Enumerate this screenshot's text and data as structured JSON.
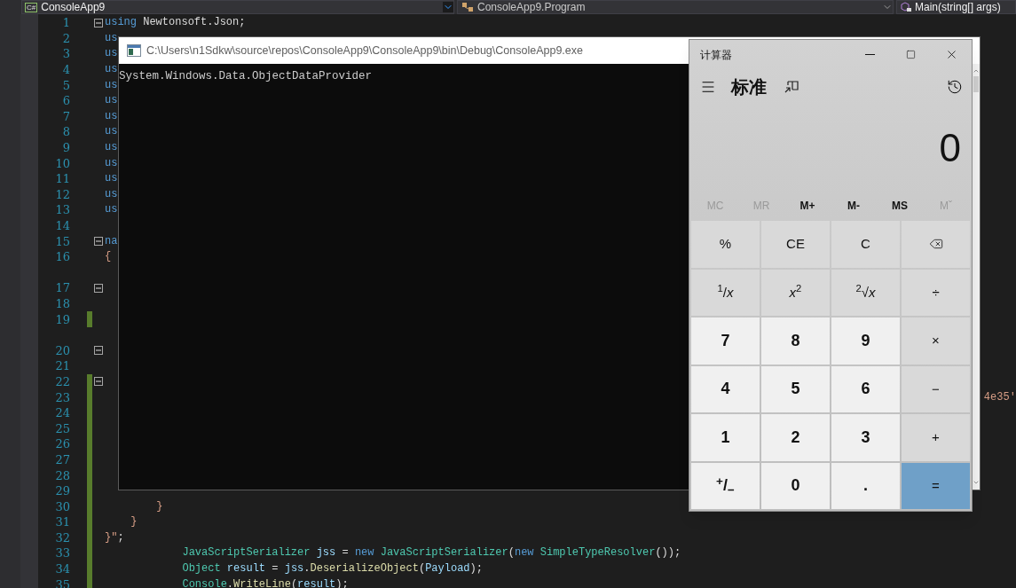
{
  "toolbar": {
    "project": {
      "badge": "C#",
      "label": "ConsoleApp9"
    },
    "class": {
      "label": "ConsoleApp9.Program"
    },
    "member": {
      "label": "Main(string[] args)"
    }
  },
  "editor": {
    "lines": [
      {
        "number": "1",
        "foldable": true,
        "changed": false,
        "codelens": false,
        "tokens": [
          {
            "text": "using",
            "kind": "keyword"
          },
          {
            "text": " Newtonsoft.Json;",
            "kind": "plain"
          }
        ]
      },
      {
        "number": "2",
        "foldable": false,
        "changed": false,
        "codelens": false,
        "tokens": [
          {
            "text": "us",
            "kind": "keyword"
          }
        ]
      },
      {
        "number": "3",
        "foldable": false,
        "changed": false,
        "codelens": false,
        "tokens": [
          {
            "text": "us",
            "kind": "keyword"
          }
        ]
      },
      {
        "number": "4",
        "foldable": false,
        "changed": false,
        "codelens": false,
        "tokens": [
          {
            "text": "us",
            "kind": "keyword"
          }
        ]
      },
      {
        "number": "5",
        "foldable": false,
        "changed": false,
        "codelens": false,
        "tokens": [
          {
            "text": "us",
            "kind": "keyword"
          }
        ]
      },
      {
        "number": "6",
        "foldable": false,
        "changed": false,
        "codelens": false,
        "tokens": [
          {
            "text": "us",
            "kind": "keyword"
          }
        ]
      },
      {
        "number": "7",
        "foldable": false,
        "changed": false,
        "codelens": false,
        "tokens": [
          {
            "text": "us",
            "kind": "keyword"
          }
        ]
      },
      {
        "number": "8",
        "foldable": false,
        "changed": false,
        "codelens": false,
        "tokens": [
          {
            "text": "us",
            "kind": "keyword"
          }
        ]
      },
      {
        "number": "9",
        "foldable": false,
        "changed": false,
        "codelens": false,
        "tokens": [
          {
            "text": "us",
            "kind": "keyword"
          }
        ]
      },
      {
        "number": "10",
        "foldable": false,
        "changed": false,
        "codelens": false,
        "tokens": [
          {
            "text": "us",
            "kind": "keyword"
          }
        ]
      },
      {
        "number": "11",
        "foldable": false,
        "changed": false,
        "codelens": false,
        "tokens": [
          {
            "text": "us",
            "kind": "keyword"
          }
        ]
      },
      {
        "number": "12",
        "foldable": false,
        "changed": false,
        "codelens": false,
        "tokens": [
          {
            "text": "us",
            "kind": "keyword"
          }
        ]
      },
      {
        "number": "13",
        "foldable": false,
        "changed": false,
        "codelens": false,
        "tokens": [
          {
            "text": "us",
            "kind": "keyword"
          }
        ]
      },
      {
        "number": "14",
        "foldable": false,
        "changed": false,
        "codelens": false
      },
      {
        "number": "15",
        "foldable": true,
        "changed": false,
        "codelens": false,
        "tokens": [
          {
            "text": "na",
            "kind": "keyword"
          }
        ]
      },
      {
        "number": "16",
        "foldable": false,
        "changed": false,
        "codelens": false,
        "tokens": [
          {
            "text": "{",
            "kind": "string"
          }
        ]
      },
      {
        "number": "17",
        "foldable": true,
        "changed": false,
        "codelens": true
      },
      {
        "number": "18",
        "foldable": false,
        "changed": false,
        "codelens": false
      },
      {
        "number": "19",
        "foldable": false,
        "changed": true,
        "codelens": false
      },
      {
        "number": "20",
        "foldable": true,
        "changed": false,
        "codelens": true
      },
      {
        "number": "21",
        "foldable": false,
        "changed": false,
        "codelens": false
      },
      {
        "number": "22",
        "foldable": true,
        "changed": true,
        "codelens": false
      },
      {
        "number": "23",
        "foldable": false,
        "changed": true,
        "codelens": false,
        "tokens": [
          {
            "text": "                                                                                                                                        4e35'",
            "kind": "string"
          }
        ]
      },
      {
        "number": "24",
        "foldable": false,
        "changed": true,
        "codelens": false
      },
      {
        "number": "25",
        "foldable": false,
        "changed": true,
        "codelens": false
      },
      {
        "number": "26",
        "foldable": false,
        "changed": true,
        "codelens": false
      },
      {
        "number": "27",
        "foldable": false,
        "changed": true,
        "codelens": false
      },
      {
        "number": "28",
        "foldable": false,
        "changed": true,
        "codelens": false
      },
      {
        "number": "29",
        "foldable": false,
        "changed": true,
        "codelens": false
      },
      {
        "number": "30",
        "foldable": false,
        "changed": true,
        "codelens": false,
        "tokens": [
          {
            "text": "        }",
            "kind": "string"
          }
        ]
      },
      {
        "number": "31",
        "foldable": false,
        "changed": true,
        "codelens": false,
        "tokens": [
          {
            "text": "    }",
            "kind": "string"
          }
        ]
      },
      {
        "number": "32",
        "foldable": false,
        "changed": true,
        "codelens": false,
        "tokens": [
          {
            "text": "}\"",
            "kind": "string"
          },
          {
            "text": ";",
            "kind": "plain"
          }
        ]
      },
      {
        "number": "33",
        "foldable": false,
        "changed": true,
        "codelens": false,
        "tokens": [
          {
            "text": "            JavaScriptSerializer",
            "kind": "type"
          },
          {
            "text": " jss",
            "kind": "variable"
          },
          {
            "text": " = ",
            "kind": "plain"
          },
          {
            "text": "new",
            "kind": "keyword"
          },
          {
            "text": " JavaScriptSerializer",
            "kind": "type"
          },
          {
            "text": "(",
            "kind": "plain"
          },
          {
            "text": "new",
            "kind": "keyword"
          },
          {
            "text": " SimpleTypeResolver",
            "kind": "type"
          },
          {
            "text": "());",
            "kind": "plain"
          }
        ]
      },
      {
        "number": "34",
        "foldable": false,
        "changed": true,
        "codelens": false,
        "tokens": [
          {
            "text": "            Object",
            "kind": "type"
          },
          {
            "text": " result",
            "kind": "variable"
          },
          {
            "text": " = ",
            "kind": "plain"
          },
          {
            "text": "jss",
            "kind": "variable"
          },
          {
            "text": ".",
            "kind": "plain"
          },
          {
            "text": "DeserializeObject",
            "kind": "method"
          },
          {
            "text": "(",
            "kind": "plain"
          },
          {
            "text": "Payload",
            "kind": "variable"
          },
          {
            "text": ");",
            "kind": "plain"
          }
        ]
      },
      {
        "number": "35",
        "foldable": false,
        "changed": true,
        "codelens": false,
        "tokens": [
          {
            "text": "            Console",
            "kind": "type"
          },
          {
            "text": ".",
            "kind": "plain"
          },
          {
            "text": "WriteLine",
            "kind": "method"
          },
          {
            "text": "(",
            "kind": "plain"
          },
          {
            "text": "result",
            "kind": "variable"
          },
          {
            "text": ");",
            "kind": "plain"
          }
        ]
      }
    ]
  },
  "console": {
    "title": "C:\\Users\\n1Sdkw\\source\\repos\\ConsoleApp9\\ConsoleApp9\\bin\\Debug\\ConsoleApp9.exe",
    "output": "System.Windows.Data.ObjectDataProvider"
  },
  "calculator": {
    "title": "计算器",
    "mode": "标准",
    "display": "0",
    "memory": [
      {
        "label": "MC",
        "disabled": true
      },
      {
        "label": "MR",
        "disabled": true
      },
      {
        "label": "M+",
        "disabled": false
      },
      {
        "label": "M-",
        "disabled": false
      },
      {
        "label": "MS",
        "disabled": false
      },
      {
        "label": "Mˇ",
        "disabled": true
      }
    ],
    "keys": [
      {
        "label": "%",
        "kind": "function"
      },
      {
        "label": "CE",
        "kind": "function"
      },
      {
        "label": "C",
        "kind": "function"
      },
      {
        "kind": "backspace"
      },
      {
        "label": "$^{1}$/*x*",
        "kind": "function"
      },
      {
        "label": "*x*$^{2}$",
        "kind": "function"
      },
      {
        "label": "$^{2}$√*x*",
        "kind": "function"
      },
      {
        "label": "÷",
        "kind": "operator"
      },
      {
        "label": "7",
        "kind": "digit"
      },
      {
        "label": "8",
        "kind": "digit"
      },
      {
        "label": "9",
        "kind": "digit"
      },
      {
        "label": "×",
        "kind": "operator"
      },
      {
        "label": "4",
        "kind": "digit"
      },
      {
        "label": "5",
        "kind": "digit"
      },
      {
        "label": "6",
        "kind": "digit"
      },
      {
        "label": "−",
        "kind": "operator"
      },
      {
        "label": "1",
        "kind": "digit"
      },
      {
        "label": "2",
        "kind": "digit"
      },
      {
        "label": "3",
        "kind": "digit"
      },
      {
        "label": "+",
        "kind": "operator"
      },
      {
        "label": "$^{+}$/$_{−}$",
        "kind": "digit"
      },
      {
        "label": "0",
        "kind": "digit"
      },
      {
        "label": ".",
        "kind": "digit"
      },
      {
        "label": "=",
        "kind": "equals"
      }
    ]
  }
}
